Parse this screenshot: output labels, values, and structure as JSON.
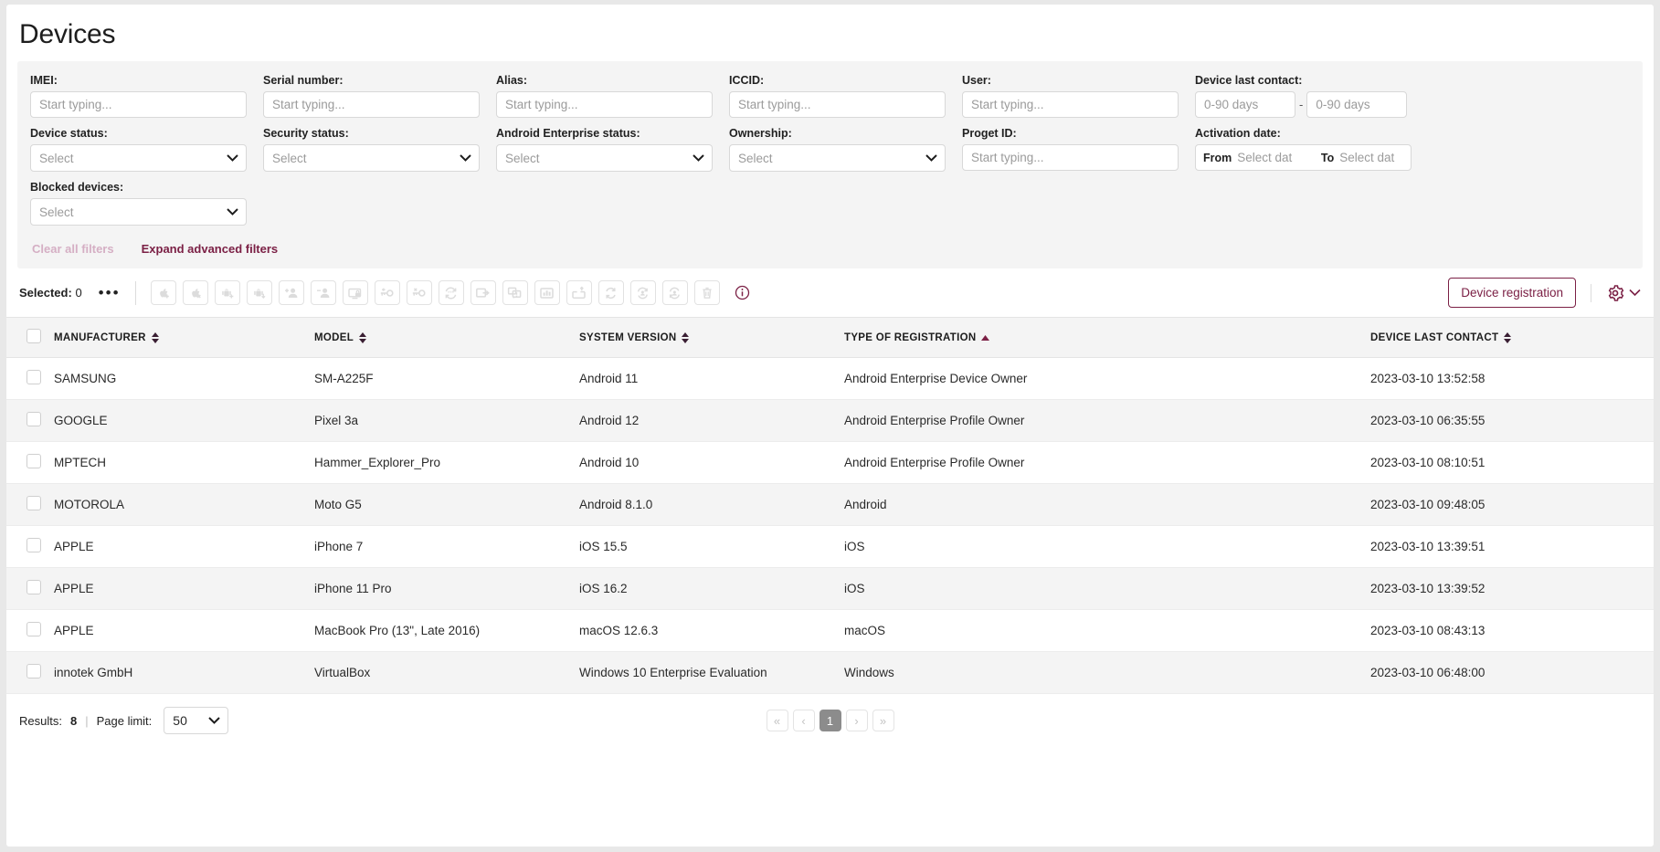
{
  "page": {
    "title": "Devices"
  },
  "filters": {
    "row1": [
      {
        "label": "IMEI:",
        "placeholder": "Start typing...",
        "name": "imei"
      },
      {
        "label": "Serial number:",
        "placeholder": "Start typing...",
        "name": "serial-number"
      },
      {
        "label": "Alias:",
        "placeholder": "Start typing...",
        "name": "alias"
      },
      {
        "label": "ICCID:",
        "placeholder": "Start typing...",
        "name": "iccid"
      },
      {
        "label": "User:",
        "placeholder": "Start typing...",
        "name": "user"
      }
    ],
    "device_last_contact": {
      "label": "Device last contact:",
      "from_placeholder": "0-90 days",
      "to_placeholder": "0-90 days",
      "separator": "-"
    },
    "row2": [
      {
        "label": "Device status:",
        "value": "Select",
        "name": "device-status"
      },
      {
        "label": "Security status:",
        "value": "Select",
        "name": "security-status"
      },
      {
        "label": "Android Enterprise status:",
        "value": "Select",
        "name": "android-enterprise-status"
      },
      {
        "label": "Ownership:",
        "value": "Select",
        "name": "ownership"
      }
    ],
    "proget_id": {
      "label": "Proget ID:",
      "placeholder": "Start typing..."
    },
    "activation_date": {
      "label": "Activation date:",
      "from_label": "From",
      "from_placeholder": "Select dat",
      "to_label": "To",
      "to_placeholder": "Select dat"
    },
    "blocked_devices": {
      "label": "Blocked devices:",
      "value": "Select"
    },
    "clear_all": "Clear all filters",
    "expand_advanced": "Expand advanced filters"
  },
  "actionbar": {
    "selected_label": "Selected:",
    "selected_count": "0",
    "more_menu": "•••",
    "device_registration": "Device registration",
    "icons": [
      "apple-add-icon",
      "apple-remove-icon",
      "android-add-icon",
      "android-download-icon",
      "user-add-icon",
      "user-remove-icon",
      "screen-lock-icon",
      "key-add-icon",
      "key-remove-icon",
      "password-refresh-icon",
      "screen-transfer-icon",
      "message-alert-icon",
      "chart-bar-icon",
      "upload-box-icon",
      "sync-icon",
      "refresh-user-icon",
      "refresh-device-icon",
      "trash-icon"
    ],
    "info_icon": "info-icon",
    "settings_icon": "gear-icon",
    "settings_chevron": "chevron-down-icon"
  },
  "table": {
    "columns": [
      {
        "label": "MANUFACTURER",
        "sort": "none"
      },
      {
        "label": "MODEL",
        "sort": "none"
      },
      {
        "label": "SYSTEM VERSION",
        "sort": "none"
      },
      {
        "label": "TYPE OF REGISTRATION",
        "sort": "asc"
      },
      {
        "label": "DEVICE LAST CONTACT",
        "sort": "none"
      }
    ],
    "rows": [
      {
        "manufacturer": "SAMSUNG",
        "model": "SM-A225F",
        "system_version": "Android 11",
        "type_of_registration": "Android Enterprise Device Owner",
        "device_last_contact": "2023-03-10 13:52:58"
      },
      {
        "manufacturer": "GOOGLE",
        "model": "Pixel 3a",
        "system_version": "Android 12",
        "type_of_registration": "Android Enterprise Profile Owner",
        "device_last_contact": "2023-03-10 06:35:55"
      },
      {
        "manufacturer": "MPTECH",
        "model": "Hammer_Explorer_Pro",
        "system_version": "Android 10",
        "type_of_registration": "Android Enterprise Profile Owner",
        "device_last_contact": "2023-03-10 08:10:51"
      },
      {
        "manufacturer": "MOTOROLA",
        "model": "Moto G5",
        "system_version": "Android 8.1.0",
        "type_of_registration": "Android",
        "device_last_contact": "2023-03-10 09:48:05"
      },
      {
        "manufacturer": "APPLE",
        "model": "iPhone 7",
        "system_version": "iOS 15.5",
        "type_of_registration": "iOS",
        "device_last_contact": "2023-03-10 13:39:51"
      },
      {
        "manufacturer": "APPLE",
        "model": "iPhone 11 Pro",
        "system_version": "iOS 16.2",
        "type_of_registration": "iOS",
        "device_last_contact": "2023-03-10 13:39:52"
      },
      {
        "manufacturer": "APPLE",
        "model": "MacBook Pro (13\", Late 2016)",
        "system_version": "macOS 12.6.3",
        "type_of_registration": "macOS",
        "device_last_contact": "2023-03-10 08:43:13"
      },
      {
        "manufacturer": "innotek GmbH",
        "model": "VirtualBox",
        "system_version": "Windows 10 Enterprise Evaluation",
        "type_of_registration": "Windows",
        "device_last_contact": "2023-03-10 06:48:00"
      }
    ]
  },
  "footer": {
    "results_label": "Results:",
    "results_count": "8",
    "separator": "|",
    "page_limit_label": "Page limit:",
    "page_limit_value": "50",
    "pagination": {
      "first": "«",
      "prev": "‹",
      "current": "1",
      "next": "›",
      "last": "»"
    }
  },
  "colors": {
    "brand": "#7b2045",
    "panel_bg": "#f4f4f4",
    "row_alt": "#f4f4f4",
    "active_page": "#8c8c8c"
  }
}
